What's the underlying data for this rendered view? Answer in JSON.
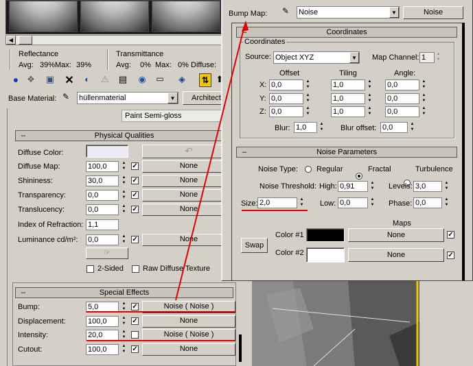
{
  "sample_bar": {
    "reflectance_label": "Reflectance",
    "transmittance_label": "Transmittance",
    "avg_label": "Avg:",
    "reflect_avg": "39%",
    "max_label": "Max:",
    "reflect_max": "39%",
    "trans_avg": "0%",
    "trans_max": "0%",
    "diffuse_label": "Diffuse:"
  },
  "base_material": {
    "label": "Base Material:",
    "value": "hüllenmaterial",
    "architect_label": "Architect",
    "template": "Paint Semi-gloss"
  },
  "physical": {
    "title": "Physical Qualities",
    "diffuse_color": "Diffuse Color:",
    "rows": [
      {
        "label": "Diffuse Map:",
        "value": "100,0",
        "map": "None",
        "checked": "✓"
      },
      {
        "label": "Shininess:",
        "value": "30,0",
        "map": "None",
        "checked": "✓"
      },
      {
        "label": "Transparency:",
        "value": "0,0",
        "map": "None",
        "checked": "✓"
      },
      {
        "label": "Translucency:",
        "value": "0,0",
        "map": "None",
        "checked": "✓"
      }
    ],
    "ior_label": "Index of Refraction:",
    "ior_value": "1,1",
    "lum_label": "Luminance cd/m²:",
    "lum_value": "0,0",
    "lum_map": "None",
    "two_sided": "2-Sided",
    "raw_diffuse": "Raw Diffuse Texture"
  },
  "special": {
    "title": "Special Effects",
    "rows": [
      {
        "label": "Bump:",
        "value": "5,0",
        "map": "Noise  ( Noise )",
        "checked": "✓"
      },
      {
        "label": "Displacement:",
        "value": "100,0",
        "map": "None",
        "checked": "✓"
      },
      {
        "label": "Intensity:",
        "value": "20,0",
        "map": "Noise  ( Noise )",
        "checked": ""
      },
      {
        "label": "Cutout:",
        "value": "100,0",
        "map": "None",
        "checked": "✓"
      }
    ]
  },
  "bump_header": {
    "label": "Bump Map:",
    "name": "Noise",
    "type": "Noise"
  },
  "coordinates": {
    "title": "Coordinates",
    "group": "Coordinates",
    "source_label": "Source:",
    "source_value": "Object XYZ",
    "channel_label": "Map Channel:",
    "channel_value": "1",
    "offset_label": "Offset",
    "tiling_label": "Tiling",
    "angle_label": "Angle:",
    "axes": [
      {
        "axis": "X:",
        "offset": "0,0",
        "tiling": "1,0",
        "angle": "0,0"
      },
      {
        "axis": "Y:",
        "offset": "0,0",
        "tiling": "1,0",
        "angle": "0,0"
      },
      {
        "axis": "Z:",
        "offset": "0,0",
        "tiling": "1,0",
        "angle": "0,0"
      }
    ],
    "blur_label": "Blur:",
    "blur_value": "1,0",
    "blur_offset_label": "Blur offset:",
    "blur_offset_value": "0,0"
  },
  "noise": {
    "title": "Noise Parameters",
    "type_label": "Noise Type:",
    "regular": "Regular",
    "fractal": "Fractal",
    "turbulence": "Turbulence",
    "threshold_label": "Noise Threshold:",
    "high_label": "High:",
    "high_value": "0,91",
    "levels_label": "Levels:",
    "levels_value": "3,0",
    "size_label": "Size:",
    "size_value": "2,0",
    "low_label": "Low:",
    "low_value": "0,0",
    "phase_label": "Phase:",
    "phase_value": "0,0",
    "maps_label": "Maps",
    "swap": "Swap",
    "color1_label": "Color #1",
    "color1_map": "None",
    "color1": "#000000",
    "color2_label": "Color #2",
    "color2_map": "None",
    "color2": "#ffffff"
  }
}
